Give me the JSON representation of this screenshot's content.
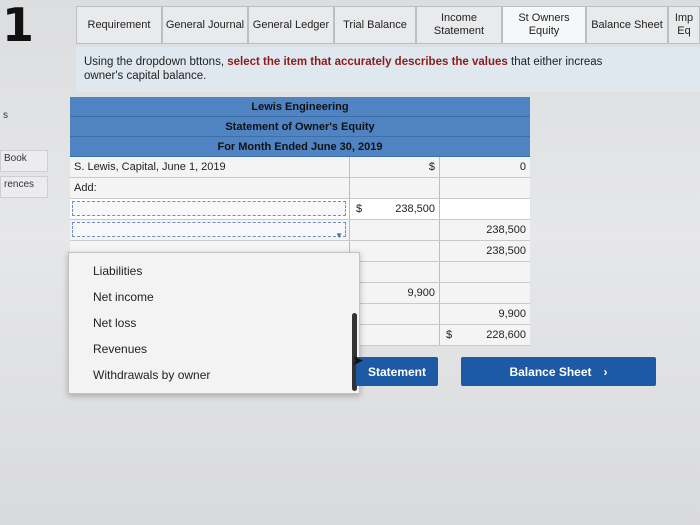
{
  "question_number": "1",
  "sidebar": {
    "item0": "s",
    "item1": "Book",
    "item2": "rences"
  },
  "tabs": [
    {
      "label": "Requirement"
    },
    {
      "label": "General Journal"
    },
    {
      "label": "General Ledger"
    },
    {
      "label": "Trial Balance"
    },
    {
      "label": "Income Statement"
    },
    {
      "label": "St Owners Equity"
    },
    {
      "label": "Balance Sheet"
    },
    {
      "label": "Imp Eq"
    }
  ],
  "instruction": {
    "prefix": "Using the dropdown b",
    "middle": "ttons, ",
    "bold": "select the item that accurately describes the values",
    "suffix": " that either increas",
    "line2": "owner's capital balance."
  },
  "statement": {
    "company": "Lewis Engineering",
    "title": "Statement of Owner's Equity",
    "period": "For Month Ended June 30, 2019",
    "rows": [
      {
        "label": "S. Lewis, Capital, June 1, 2019",
        "col2": "$",
        "col3_sym": "",
        "col3": "0"
      },
      {
        "label": "Add:",
        "col2": "",
        "col3": ""
      },
      {
        "label": "",
        "col2_sym": "$",
        "col2": "238,500",
        "col3": ""
      },
      {
        "label": "",
        "col2": "",
        "col3": "238,500"
      },
      {
        "label": "",
        "col2": "",
        "col3": "238,500"
      },
      {
        "label": "",
        "col2": "",
        "col3": ""
      },
      {
        "label": "",
        "col2": "9,900",
        "col3": ""
      },
      {
        "label": "",
        "col2": "",
        "col3": "9,900"
      },
      {
        "label": "",
        "col2_sym": "$",
        "col3": "228,600"
      }
    ]
  },
  "dropdown_options": [
    "Liabilities",
    "Net income",
    "Net loss",
    "Revenues",
    "Withdrawals by owner"
  ],
  "buttons": {
    "prev_label": "Statement",
    "next_label": "Balance Sheet",
    "next_icon": "chevron-right-icon"
  },
  "colors": {
    "header_blue": "#4f83c2",
    "button_blue": "#1d5aa5",
    "emphasis": "#8a1c1c"
  }
}
